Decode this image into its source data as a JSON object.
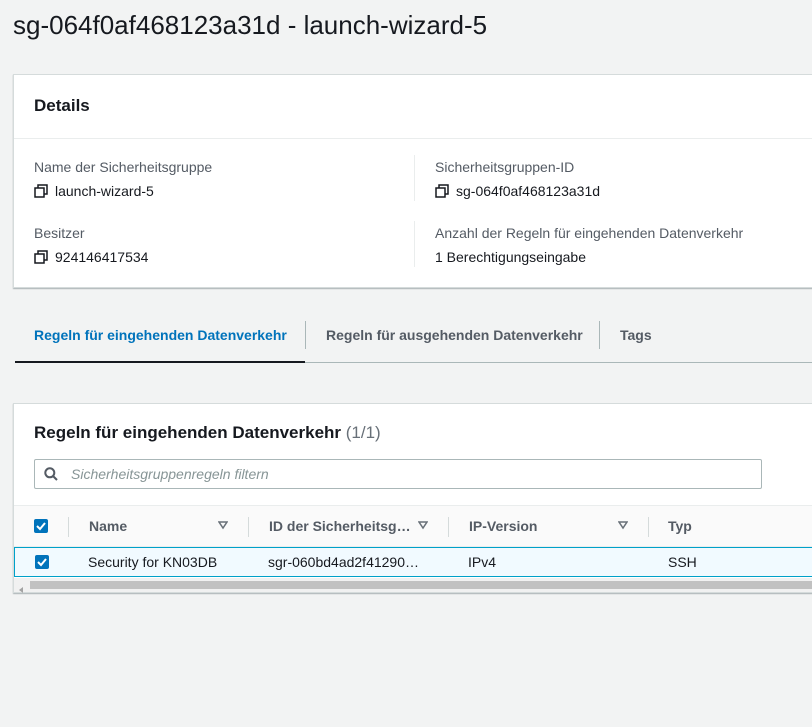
{
  "page": {
    "title": "sg-064f0af468123a31d - launch-wizard-5"
  },
  "details": {
    "heading": "Details",
    "fields": {
      "group_name": {
        "label": "Name der Sicherheitsgruppe",
        "value": "launch-wizard-5"
      },
      "group_id": {
        "label": "Sicherheitsgruppen-ID",
        "value": "sg-064f0af468123a31d"
      },
      "owner": {
        "label": "Besitzer",
        "value": "924146417534"
      },
      "inbound_count": {
        "label": "Anzahl der Regeln für eingehenden Datenverkehr",
        "value": "1 Berechtigungseingabe"
      }
    }
  },
  "tabs": [
    {
      "label": "Regeln für eingehenden Datenverkehr",
      "active": true
    },
    {
      "label": "Regeln für ausgehenden Datenverkehr",
      "active": false
    },
    {
      "label": "Tags",
      "active": false
    }
  ],
  "rules": {
    "title": "Regeln für eingehenden Datenverkehr",
    "count": "(1/1)",
    "search_placeholder": "Sicherheitsgruppenregeln filtern",
    "columns": [
      "Name",
      "ID der Sicherheitsg…",
      "IP-Version",
      "Typ"
    ],
    "rows": [
      {
        "selected": true,
        "name": "Security for KN03DB",
        "rule_id": "sgr-060bd4ad2f41290…",
        "ip_version": "IPv4",
        "type": "SSH"
      }
    ]
  },
  "colors": {
    "accent": "#0073bb",
    "selected_row_bg": "#f1faff",
    "selected_row_border": "#00a1c9",
    "page_bg": "#f2f3f3"
  }
}
